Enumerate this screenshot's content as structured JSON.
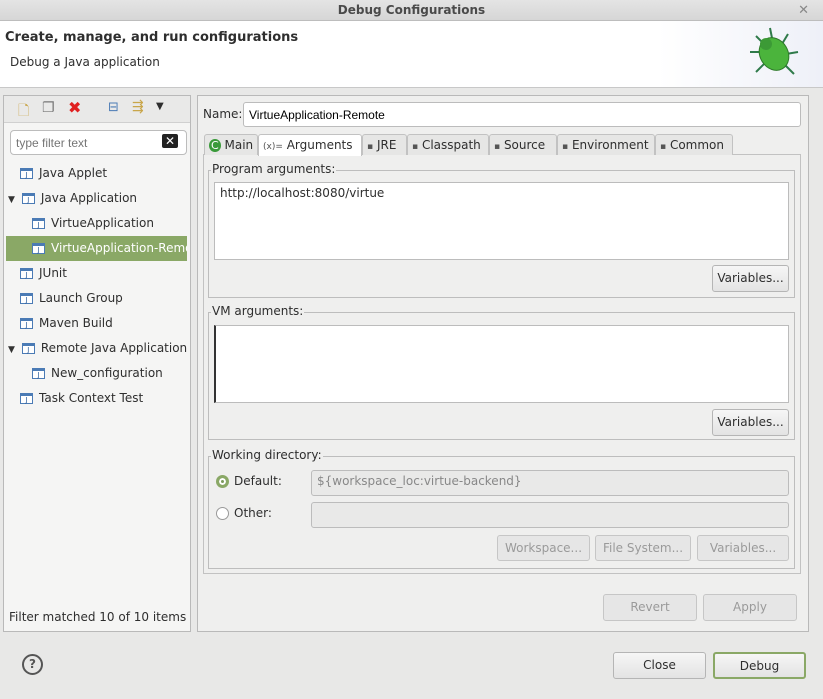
{
  "window": {
    "title": "Debug Configurations",
    "close": "✕"
  },
  "header": {
    "title": "Create, manage, and run configurations",
    "subtitle": "Debug a Java application"
  },
  "left": {
    "filter_placeholder": "type filter text",
    "tree": [
      {
        "label": "Java Applet",
        "level": 0,
        "icon": "java-applet-icon"
      },
      {
        "label": "Java Application",
        "level": 0,
        "expanded": true,
        "icon": "java-application-icon"
      },
      {
        "label": "VirtueApplication",
        "level": 1,
        "icon": "java-application-icon"
      },
      {
        "label": "VirtueApplication-Remote",
        "level": 1,
        "selected": true,
        "icon": "java-application-icon"
      },
      {
        "label": "JUnit",
        "level": 0,
        "icon": "junit-icon"
      },
      {
        "label": "Launch Group",
        "level": 0,
        "icon": "launch-group-icon"
      },
      {
        "label": "Maven Build",
        "level": 0,
        "icon": "maven-icon"
      },
      {
        "label": "Remote Java Application",
        "level": 0,
        "expanded": true,
        "icon": "remote-java-icon"
      },
      {
        "label": "New_configuration",
        "level": 1,
        "icon": "remote-java-icon"
      },
      {
        "label": "Task Context Test",
        "level": 0,
        "icon": "task-context-icon"
      }
    ],
    "status": "Filter matched 10 of 10 items"
  },
  "right": {
    "name_label": "Name:",
    "name_value": "VirtueApplication-Remote",
    "tabs": [
      "Main",
      "Arguments",
      "JRE",
      "Classpath",
      "Source",
      "Environment",
      "Common"
    ],
    "tab_icons": [
      "C",
      "(x)=",
      "",
      "",
      "",
      "",
      ""
    ],
    "program_args_label": "Program arguments:",
    "program_args_value": "http://localhost:8080/virtue",
    "vm_args_label": "VM arguments:",
    "vm_args_value": "",
    "variables": "Variables...",
    "working_dir_label": "Working directory:",
    "default_label": "Default:",
    "default_value": "${workspace_loc:virtue-backend}",
    "other_label": "Other:",
    "workspace": "Workspace...",
    "file_system": "File System...",
    "revert": "Revert",
    "apply": "Apply"
  },
  "footer": {
    "help": "?",
    "close": "Close",
    "debug": "Debug"
  }
}
